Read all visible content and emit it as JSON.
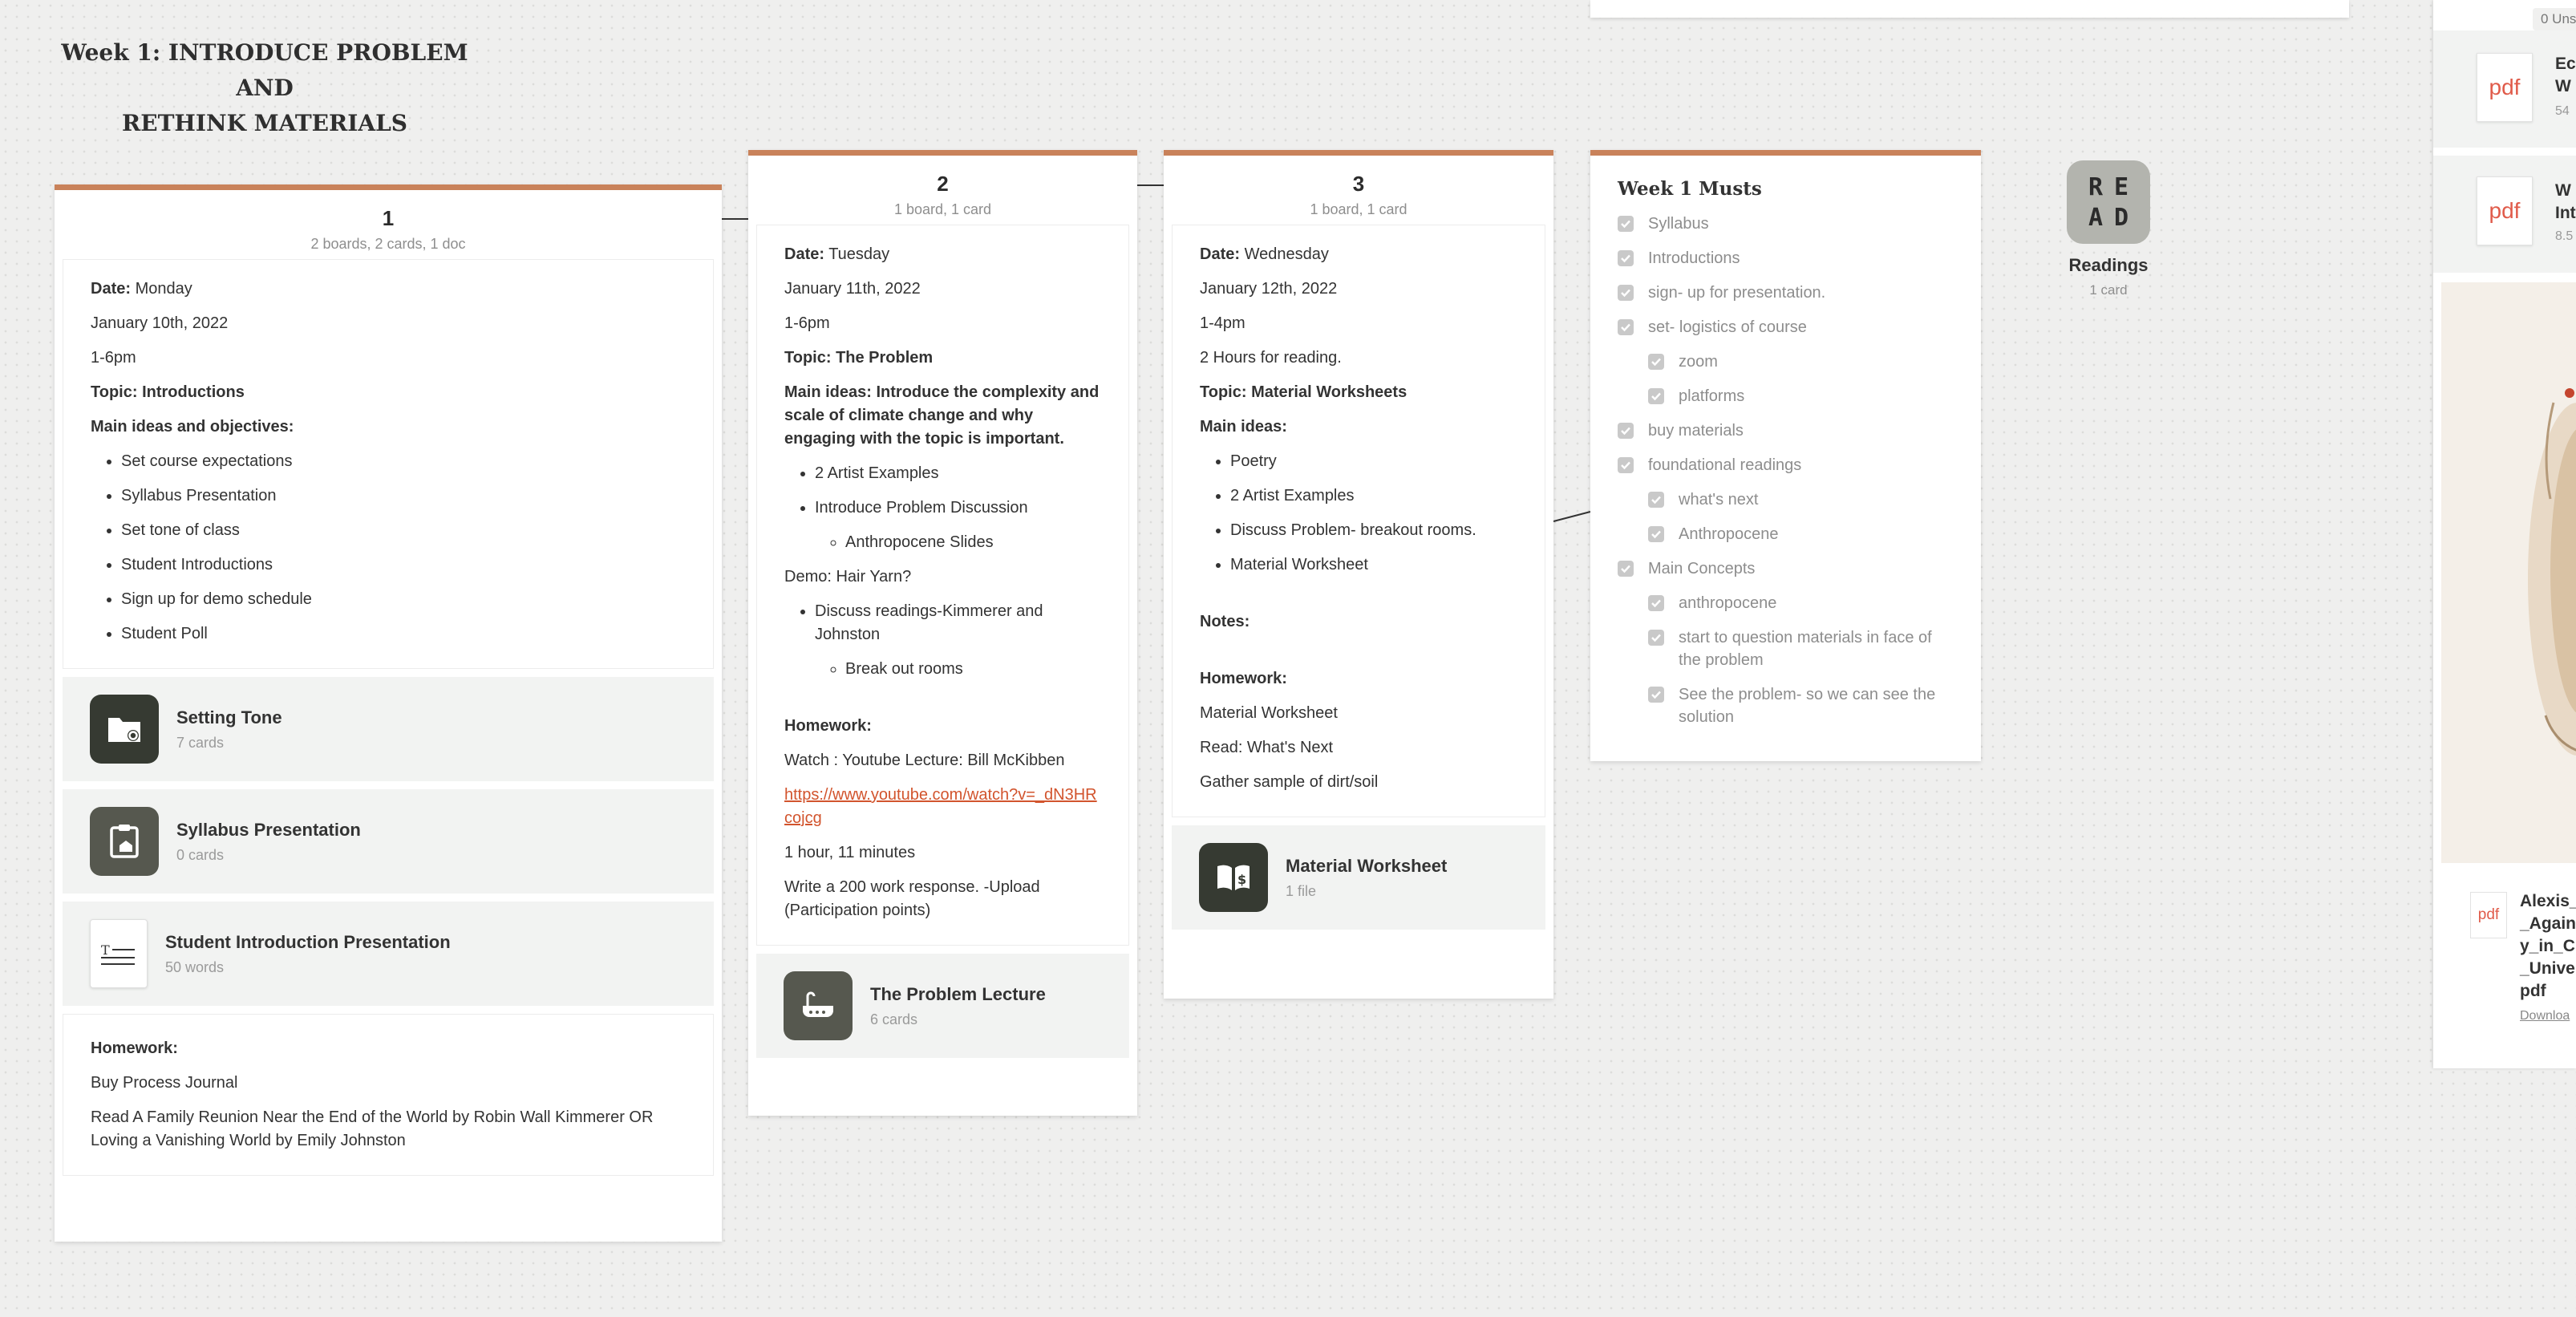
{
  "board": {
    "title_line1": "Week 1: INTRODUCE PROBLEM AND",
    "title_line2": "RETHINK MATERIALS"
  },
  "col1": {
    "number": "1",
    "meta": "2 boards, 2 cards, 1 doc",
    "date_label": "Date:",
    "date_day": " Monday",
    "date": "January 10th, 2022",
    "time": "1-6pm",
    "topic": "Topic:  Introductions",
    "ideas_label": "Main ideas and objectives:",
    "ideas": [
      "Set course expectations",
      "Syllabus Presentation",
      "Set tone of class",
      "Student Introductions",
      "Sign up for demo schedule",
      "Student Poll"
    ],
    "boards": [
      {
        "title": "Setting Tone",
        "sub": "7 cards"
      },
      {
        "title": "Syllabus Presentation",
        "sub": "0 cards"
      },
      {
        "title": "Student Introduction Presentation",
        "sub": "50 words"
      }
    ],
    "hw_label": "Homework:",
    "hw1": "Buy Process Journal",
    "hw2": "Read A Family Reunion Near the End of the World by Robin Wall Kimmerer OR Loving a Vanishing World by Emily Johnston"
  },
  "col2": {
    "number": "2",
    "meta": "1 board, 1 card",
    "date_label": "Date:",
    "date_day": " Tuesday",
    "date": "January 11th, 2022",
    "time": "1-6pm",
    "topic": "Topic: The Problem",
    "ideas": "Main ideas: Introduce the complexity and scale of climate change and why engaging with the topic is important.",
    "b1": " 2 Artist Examples",
    "b2": "Introduce Problem Discussion",
    "b2a": "Anthropocene Slides",
    "demo": "Demo: Hair Yarn?",
    "b3": "Discuss readings-Kimmerer and Johnston",
    "b3a": "Break out rooms",
    "hw_label": "Homework:",
    "watch": "Watch : Youtube Lecture: Bill McKibben",
    "link": "https://www.youtube.com/watch?v=_dN3HRcojcg",
    "duration": "1 hour, 11 minutes",
    "write": "Write a 200 work response. -Upload (Participation points)",
    "board": {
      "title": "The Problem Lecture",
      "sub": "6 cards"
    }
  },
  "col3": {
    "number": "3",
    "meta": "1 board, 1 card",
    "date_label": "Date:",
    "date_day": " Wednesday",
    "date": "January 12th, 2022",
    "time": "1-4pm",
    "hours": "2 Hours for reading.",
    "topic": "Topic: Material Worksheets",
    "ideas_label": "Main ideas:",
    "ideas": [
      "Poetry",
      "2 Artist Examples",
      "Discuss Problem- breakout rooms.",
      "Material Worksheet"
    ],
    "notes": "Notes:",
    "hw_label": "Homework:",
    "hw": [
      "Material Worksheet",
      "Read: What's Next",
      "Gather sample of dirt/soil"
    ],
    "board": {
      "title": "Material Worksheet",
      "sub": "1 file"
    }
  },
  "musts": {
    "title": "Week 1 Musts",
    "items": [
      {
        "text": "Syllabus",
        "sub": false
      },
      {
        "text": "Introductions",
        "sub": false
      },
      {
        "text": "sign- up for presentation.",
        "sub": false
      },
      {
        "text": "set- logistics of course",
        "sub": false
      },
      {
        "text": "zoom",
        "sub": true
      },
      {
        "text": "platforms",
        "sub": true
      },
      {
        "text": "buy materials",
        "sub": false
      },
      {
        "text": "foundational readings",
        "sub": false
      },
      {
        "text": "what's next",
        "sub": true
      },
      {
        "text": "Anthropocene",
        "sub": true
      },
      {
        "text": "Main Concepts",
        "sub": false
      },
      {
        "text": "anthropocene",
        "sub": true
      },
      {
        "text": "start to question materials in face of the problem",
        "sub": true
      },
      {
        "text": "See the problem- so we can see the solution",
        "sub": true
      }
    ]
  },
  "readings": {
    "icon_letters": [
      "R",
      "E",
      "A",
      "D"
    ],
    "label": "Readings",
    "sub": "1 card"
  },
  "right": {
    "unsorted": "0 Uns",
    "file1": {
      "badge": "pdf",
      "line1": "Ec",
      "line2": "W",
      "size": "54"
    },
    "file2": {
      "badge": "pdf",
      "line1": "W",
      "line2": "Int",
      "size": "8.5"
    },
    "bottom": {
      "badge": "pdf",
      "lines": [
        "Alexis_",
        "_Again",
        "y_in_C",
        "_Unive",
        "pdf"
      ],
      "download": "Downloa"
    }
  },
  "colors": {
    "accent": "#c9825a",
    "link": "#d2542d",
    "icon_dark": "#363a32"
  }
}
